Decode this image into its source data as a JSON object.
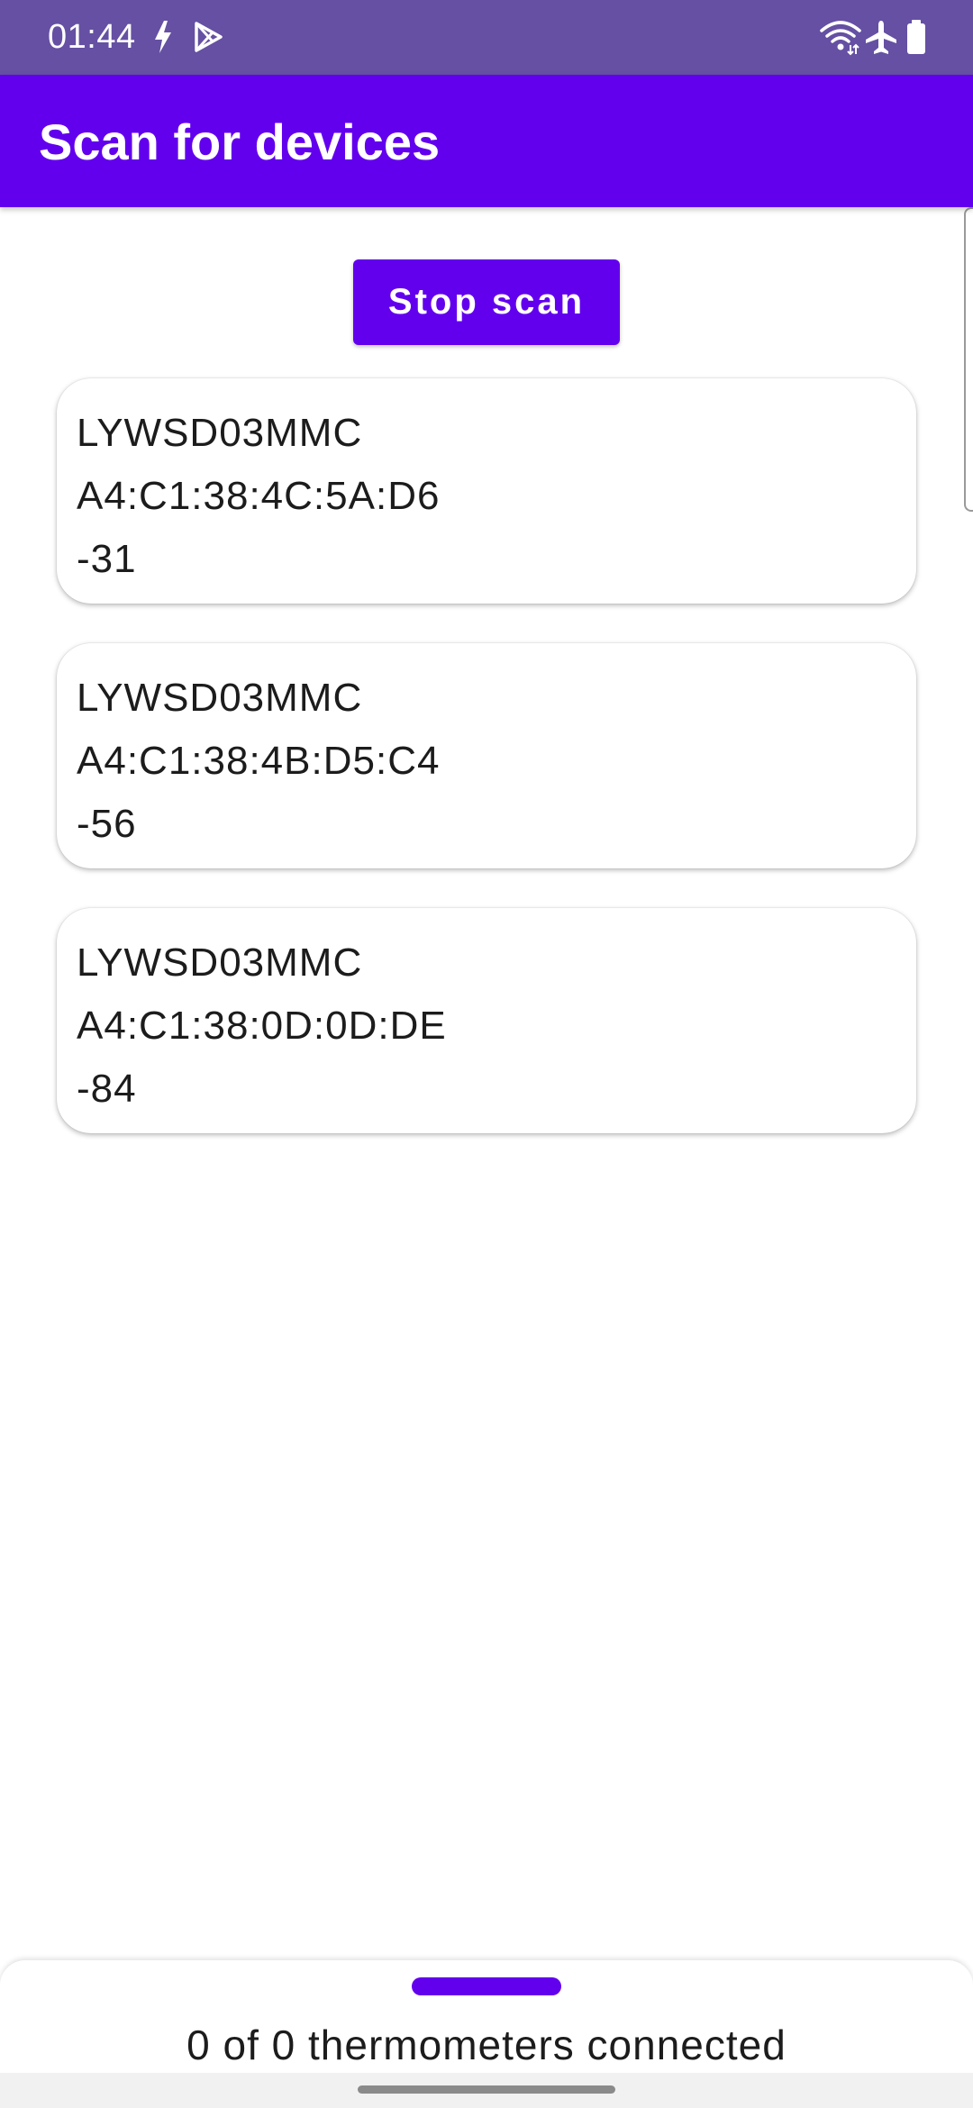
{
  "status_bar": {
    "time": "01:44",
    "icons": [
      "flash-icon",
      "play-store-icon",
      "wifi-icon",
      "airplane-mode-icon",
      "battery-icon"
    ]
  },
  "app_bar": {
    "title": "Scan for devices"
  },
  "scan_button": {
    "label": "Stop scan"
  },
  "devices": [
    {
      "name": "LYWSD03MMC",
      "address": "A4:C1:38:4C:5A:D6",
      "rssi": "-31"
    },
    {
      "name": "LYWSD03MMC",
      "address": "A4:C1:38:4B:D5:C4",
      "rssi": "-56"
    },
    {
      "name": "LYWSD03MMC",
      "address": "A4:C1:38:0D:0D:DE",
      "rssi": "-84"
    }
  ],
  "bottom_sheet": {
    "status": "0 of 0 thermometers connected"
  },
  "colors": {
    "status_bar": "#6550a3",
    "primary": "#6200ee",
    "background": "#ffffff",
    "text": "#1c1c1c"
  }
}
